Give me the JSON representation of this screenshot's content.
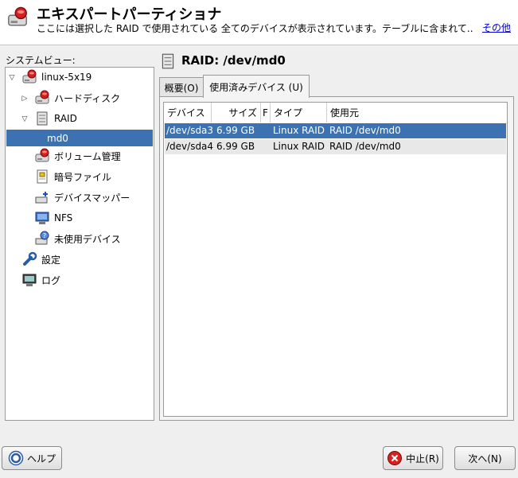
{
  "header": {
    "title": "エキスパートパーティショナ",
    "description": "ここには選択した RAID で使用されている 全てのデバイスが表示されています。テーブルに含まれて...",
    "more_link": "その他"
  },
  "system_view": {
    "label": "システムビュー:",
    "tree": [
      {
        "label": "linux-5x19",
        "icon": "computer-disk-icon"
      },
      {
        "label": "ハードディスク",
        "icon": "hard-disk-icon"
      },
      {
        "label": "RAID",
        "icon": "raid-icon"
      },
      {
        "label": "md0",
        "icon": "",
        "selected": true
      },
      {
        "label": "ボリューム管理",
        "icon": "volume-management-icon"
      },
      {
        "label": "暗号ファイル",
        "icon": "crypt-file-icon"
      },
      {
        "label": "デバイスマッパー",
        "icon": "device-mapper-icon"
      },
      {
        "label": "NFS",
        "icon": "nfs-icon"
      },
      {
        "label": "未使用デバイス",
        "icon": "unused-devices-icon"
      },
      {
        "label": "設定",
        "icon": "settings-icon"
      },
      {
        "label": "ログ",
        "icon": "log-icon"
      }
    ]
  },
  "panel": {
    "title": "RAID: /dev/md0",
    "tabs": [
      {
        "label": "概要(O)",
        "active": false
      },
      {
        "label": "使用済みデバイス (U)",
        "active": true
      }
    ],
    "table": {
      "columns": [
        "デバイス",
        "サイズ",
        "F",
        "タイプ",
        "使用元"
      ],
      "rows": [
        {
          "device": "/dev/sda3",
          "size": "6.99 GB",
          "f": "",
          "type": "Linux RAID",
          "used_by": "RAID /dev/md0",
          "selected": true
        },
        {
          "device": "/dev/sda4",
          "size": "6.99 GB",
          "f": "",
          "type": "Linux RAID",
          "used_by": "RAID /dev/md0",
          "selected": false
        }
      ]
    }
  },
  "buttons": {
    "help": "ヘルプ",
    "abort": "中止(R)",
    "next": "次へ(N)"
  },
  "colors": {
    "selection": "#3c72b1",
    "link": "#0000d0"
  }
}
